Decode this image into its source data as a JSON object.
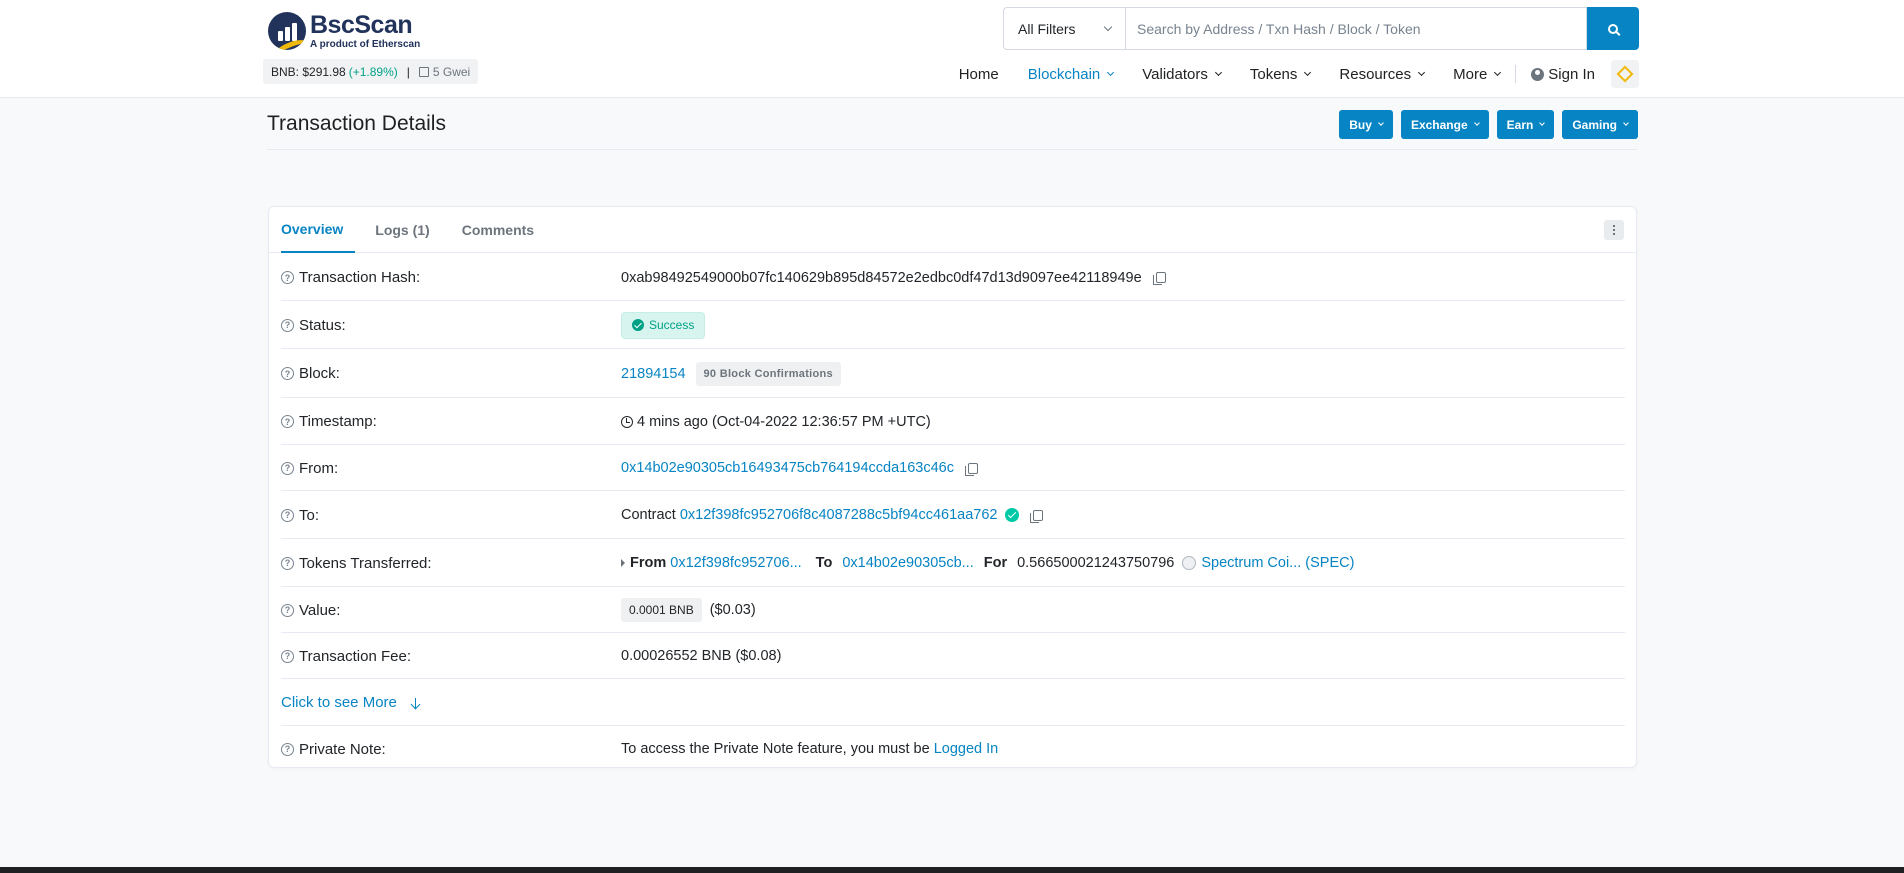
{
  "header": {
    "logo_title": "BscScan",
    "logo_sub": "A product of Etherscan",
    "price_label": "BNB: $291.98",
    "price_change": "(+1.89%)",
    "separator": "|",
    "gas": "5 Gwei",
    "filter_label": "All Filters",
    "search_placeholder": "Search by Address / Txn Hash / Block / Token",
    "nav": {
      "home": "Home",
      "blockchain": "Blockchain",
      "validators": "Validators",
      "tokens": "Tokens",
      "resources": "Resources",
      "more": "More",
      "sign_in": "Sign In"
    }
  },
  "page": {
    "title": "Transaction Details",
    "promo": {
      "buy": "Buy",
      "exchange": "Exchange",
      "earn": "Earn",
      "gaming": "Gaming"
    }
  },
  "tabs": {
    "overview": "Overview",
    "logs": "Logs (1)",
    "comments": "Comments"
  },
  "details": {
    "hash": {
      "label": "Transaction Hash:",
      "value": "0xab98492549000b07fc140629b895d84572e2edbc0df47d13d9097ee42118949e"
    },
    "status": {
      "label": "Status:",
      "value": "Success"
    },
    "block": {
      "label": "Block:",
      "value": "21894154",
      "confirmations": "90 Block Confirmations"
    },
    "timestamp": {
      "label": "Timestamp:",
      "value": "4 mins ago (Oct-04-2022 12:36:57 PM +UTC)"
    },
    "from": {
      "label": "From:",
      "value": "0x14b02e90305cb16493475cb764194ccda163c46c"
    },
    "to": {
      "label": "To:",
      "prefix": "Contract",
      "value": "0x12f398fc952706f8c4087288c5bf94cc461aa762"
    },
    "tokens": {
      "label": "Tokens Transferred:",
      "from_label": "From",
      "from_addr": "0x12f398fc952706...",
      "to_label": "To",
      "to_addr": "0x14b02e90305cb...",
      "for_label": "For",
      "amount": "0.566500021243750796",
      "token": "Spectrum Coi... (SPEC)"
    },
    "value": {
      "label": "Value:",
      "amount": "0.0001 BNB",
      "usd": "($0.03)"
    },
    "fee": {
      "label": "Transaction Fee:",
      "value": "0.00026552 BNB ($0.08)"
    },
    "more": "Click to see More",
    "note": {
      "label": "Private Note:",
      "text": "To access the Private Note feature, you must be",
      "link": "Logged In"
    }
  }
}
